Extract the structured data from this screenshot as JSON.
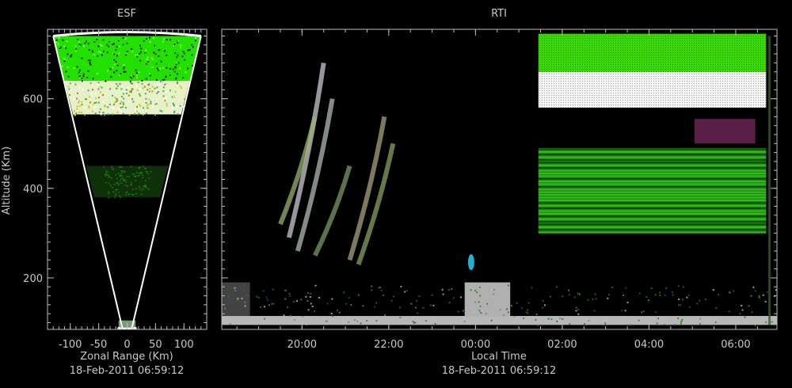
{
  "chart_data": [
    {
      "type": "heatmap",
      "title": "ESF",
      "xlabel": "Zonal Range (Km)",
      "ylabel": "Altitude (Km)",
      "timestamp": "18-Feb-2011 06:59:12",
      "x_ticks": [
        -100,
        -50,
        0,
        50,
        100
      ],
      "y_ticks": [
        200,
        400,
        600
      ],
      "xlim": [
        -140,
        140
      ],
      "ylim": [
        85,
        755
      ],
      "fan": {
        "apex_x": 0,
        "apex_y": 88,
        "edge_x_at_top": 130,
        "top_y": 740
      },
      "bands": [
        {
          "name": "green",
          "y0": 640,
          "y1": 740,
          "color": "#22e000"
        },
        {
          "name": "white-mixed",
          "y0": 565,
          "y1": 640,
          "color": "#e8f0c8"
        },
        {
          "name": "faint-green",
          "y0": 380,
          "y1": 450,
          "color": "#1a5a10"
        }
      ]
    },
    {
      "type": "heatmap",
      "title": "RTI",
      "xlabel": "Local Time",
      "ylabel": "",
      "timestamp": "18-Feb-2011 06:59:12",
      "x_ticks": [
        "20:00",
        "22:00",
        "00:00",
        "02:00",
        "04:00",
        "06:00"
      ],
      "x_tick_hours": [
        20,
        22,
        24,
        26,
        28,
        30
      ],
      "y_ticks": [
        200,
        400,
        600
      ],
      "xlim_hours": [
        18.15,
        30.95
      ],
      "ylim": [
        85,
        755
      ],
      "regions": [
        {
          "name": "green-top",
          "t0": 25.45,
          "t1": 30.7,
          "y0": 660,
          "y1": 745,
          "color": "#38d800"
        },
        {
          "name": "white-block",
          "t0": 25.45,
          "t1": 30.7,
          "y0": 580,
          "y1": 660,
          "color": "#f4f4f4"
        },
        {
          "name": "magenta-patch",
          "t0": 29.05,
          "t1": 30.45,
          "y0": 500,
          "y1": 555,
          "color": "#5a2048"
        },
        {
          "name": "green-stripes",
          "t0": 25.45,
          "t1": 30.7,
          "y0": 300,
          "y1": 490,
          "color": "#1e8a10"
        },
        {
          "name": "bottom-layer",
          "t0": 18.15,
          "t1": 30.95,
          "y0": 95,
          "y1": 115,
          "color": "#b8b8b8"
        },
        {
          "name": "evening-low",
          "t0": 18.15,
          "t1": 18.8,
          "y0": 115,
          "y1": 190,
          "color": "#707070"
        },
        {
          "name": "midnight-low",
          "t0": 23.75,
          "t1": 24.8,
          "y0": 115,
          "y1": 190,
          "color": "#b0b0b0"
        }
      ]
    }
  ]
}
